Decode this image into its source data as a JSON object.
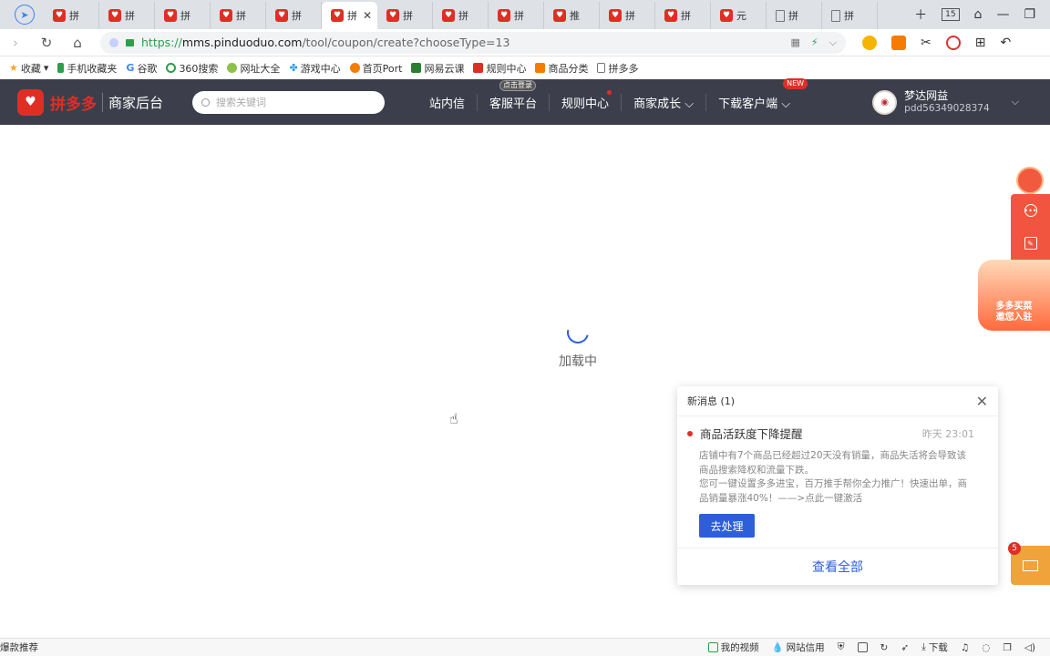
{
  "browser": {
    "tabs": [
      {
        "label": "拼",
        "icon": "pdd-favicon"
      },
      {
        "label": "拼",
        "icon": "pdd-favicon"
      },
      {
        "label": "拼",
        "icon": "pdd-favicon"
      },
      {
        "label": "拼",
        "icon": "pdd-favicon"
      },
      {
        "label": "拼",
        "icon": "pdd-favicon"
      },
      {
        "label": "拼",
        "icon": "pdd-favicon",
        "active": true
      },
      {
        "label": "拼",
        "icon": "pdd-favicon"
      },
      {
        "label": "拼",
        "icon": "pdd-favicon"
      },
      {
        "label": "拼",
        "icon": "pdd-favicon"
      },
      {
        "label": "推",
        "icon": "pdd-favicon"
      },
      {
        "label": "拼",
        "icon": "pdd-favicon"
      },
      {
        "label": "拼",
        "icon": "pdd-favicon"
      },
      {
        "label": "元",
        "icon": "pdd-favicon"
      },
      {
        "label": "拼",
        "icon": "document-favicon"
      },
      {
        "label": "拼",
        "icon": "document-favicon"
      }
    ],
    "tab_count": "15",
    "url": {
      "scheme": "https://",
      "host": "mms.pinduoduo.com",
      "path": "/tool/coupon/create?chooseType=13"
    },
    "bookmarks": [
      {
        "label": "收藏",
        "icon": "star-icon",
        "color": "#f5a623"
      },
      {
        "label": "手机收藏夹",
        "icon": "phone-icon",
        "color": "#2e9e4a"
      },
      {
        "label": "谷歌",
        "icon": "google-icon",
        "color": "#4285f4"
      },
      {
        "label": "360搜索",
        "icon": "search-360-icon",
        "color": "#2e9e4a"
      },
      {
        "label": "网址大全",
        "icon": "globe-icon",
        "color": "#8bc34a"
      },
      {
        "label": "游戏中心",
        "icon": "gamepad-icon",
        "color": "#2196f3"
      },
      {
        "label": "首页Port",
        "icon": "flame-icon",
        "color": "#f57c00"
      },
      {
        "label": "网易云课",
        "icon": "book-icon",
        "color": "#2e7d32"
      },
      {
        "label": "规则中心",
        "icon": "pdd-favicon",
        "color": "#e02e24"
      },
      {
        "label": "商品分类",
        "icon": "category-icon",
        "color": "#f57c00"
      },
      {
        "label": "拼多多",
        "icon": "document-icon",
        "color": "#777777"
      }
    ]
  },
  "header": {
    "brand": "拼多多",
    "sub": "商家后台",
    "search_placeholder": "搜索关键词",
    "nav": [
      {
        "label": "站内信"
      },
      {
        "label": "客服平台",
        "pill": "点击登录"
      },
      {
        "label": "规则中心",
        "dot": true
      },
      {
        "label": "商家成长 ⌵"
      },
      {
        "label": "下载客户端 ⌵",
        "badge": "NEW"
      }
    ],
    "user": {
      "name": "梦达网益",
      "id": "pdd56349028374"
    }
  },
  "main": {
    "loading_text": "加载中"
  },
  "side_promo": {
    "text_line1": "多多买菜",
    "text_line2": "邀您入驻"
  },
  "notification": {
    "header": "新消息 (1)",
    "title": "商品活跃度下降提醒",
    "time": "昨天 23:01",
    "body_line1": "店铺中有7个商品已经超过20天没有销量，商品失活将会导致该商品搜索降权和流量下跌。",
    "body_line2": "您可一键设置多多进宝，百万推手帮你全力推广！快速出单，商品销量暴涨40%！——>点此一键激活",
    "action": "去处理",
    "footer": "查看全部"
  },
  "mail": {
    "badge": "5"
  },
  "statusbar": {
    "left": "爆款推荐",
    "items": [
      {
        "label": "我的视频",
        "icon": "video-icon"
      },
      {
        "label": "网站信用",
        "icon": "drop-icon"
      },
      {
        "label": "",
        "icon": "shield-icon"
      },
      {
        "label": "",
        "icon": "image-icon"
      },
      {
        "label": "",
        "icon": "refresh-icon"
      },
      {
        "label": "",
        "icon": "rocket-icon"
      },
      {
        "label": "下载",
        "icon": "download-icon"
      },
      {
        "label": "",
        "icon": "headset-icon"
      },
      {
        "label": "",
        "icon": "chat-icon"
      },
      {
        "label": "",
        "icon": "window-icon"
      },
      {
        "label": "",
        "icon": "speaker-icon"
      }
    ]
  },
  "colors": {
    "pdd_red": "#e02e24",
    "header_bg": "#3c3f4b",
    "primary_blue": "#2d5fd8",
    "float_red": "#f1553f",
    "mail_orange": "#f0a23b"
  }
}
